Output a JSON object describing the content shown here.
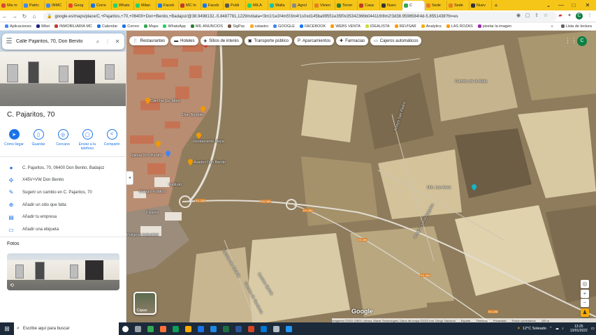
{
  "browser": {
    "tabs": [
      {
        "label": "Mis m",
        "color": "#db4437"
      },
      {
        "label": "Patric",
        "color": "#4285f4"
      },
      {
        "label": "INMC",
        "color": "#4285f4"
      },
      {
        "label": "Goog",
        "color": "#ea4335"
      },
      {
        "label": "Corre",
        "color": "#1a73e8"
      },
      {
        "label": "Whats",
        "color": "#25d366"
      },
      {
        "label": "Milan",
        "color": "#25d366"
      },
      {
        "label": "Faceb",
        "color": "#1877f2"
      },
      {
        "label": "MC In",
        "color": "#c0392b"
      },
      {
        "label": "Faceb",
        "color": "#1877f2"
      },
      {
        "label": "Publi",
        "color": "#555555"
      },
      {
        "label": "MILA",
        "color": "#25d366"
      },
      {
        "label": "Walla",
        "color": "#13c1ac"
      },
      {
        "label": "Agrol",
        "color": "#888888"
      },
      {
        "label": "Vivien",
        "color": "#e67e22"
      },
      {
        "label": "Terrer",
        "color": "#2e7d32"
      },
      {
        "label": "Casa",
        "color": "#c0392b"
      },
      {
        "label": "Nuev",
        "color": "#333333"
      },
      {
        "label": "C",
        "color": "#34a853",
        "active": true
      },
      {
        "label": "Sede",
        "color": "#e67e22"
      },
      {
        "label": "Sede",
        "color": "#e67e22"
      },
      {
        "label": "Nuev",
        "color": "#333333"
      }
    ],
    "new_tab": "+",
    "window_controls": {
      "minimize": "⌄",
      "min": "—",
      "max": "□",
      "close": "✕"
    },
    "url": "google.es/maps/place/C.+Pajaritos,+70,+06400+Don+Benito,+Badajoz/@38.9498132,-5.8487781,1229m/data=!3m1!1e3!4m5!3m4!1s0xd145ba99551e35f0x35342366b044116!8m2!3d38.9596584!4d-5.8551438?hl=es",
    "bookmarks": [
      {
        "label": "Aplicaciones",
        "color": "#4285f4"
      },
      {
        "label": "Witei",
        "color": "#1a237e"
      },
      {
        "label": "INMOBILIARIA MC",
        "color": "#c0392b"
      },
      {
        "label": "Calendar",
        "color": "#1a73e8"
      },
      {
        "label": "Correo",
        "color": "#1a73e8"
      },
      {
        "label": "Maps",
        "color": "#34a853"
      },
      {
        "label": "WhatsApp",
        "color": "#25d366"
      },
      {
        "label": "MIL ANUNCIOS",
        "color": "#2e7d32"
      },
      {
        "label": "SigPac",
        "color": "#795548"
      },
      {
        "label": "catastro",
        "color": "#f9a825"
      },
      {
        "label": "GOOGLE",
        "color": "#4285f4"
      },
      {
        "label": "FACEBOOK",
        "color": "#1877f2"
      },
      {
        "label": "WEBS VENTA",
        "color": "#ff9800"
      },
      {
        "label": "IDEALISTA",
        "color": "#cddc39"
      },
      {
        "label": "REVISAR",
        "color": "#ff9800"
      },
      {
        "label": "Analytics",
        "color": "#f9ab00"
      },
      {
        "label": "LAS ROZAS",
        "color": "#ff9800"
      },
      {
        "label": "pixelar la imagen",
        "color": "#9c27b0"
      }
    ],
    "bookmarks_more": "»",
    "reading_list": "Lista de lectura"
  },
  "sidebar": {
    "search_value": "Calle Pajaritos, 70, Don Benito",
    "place_title": "C. Pajaritos, 70",
    "actions": [
      {
        "label": "Cómo llegar",
        "icon": "directions-icon",
        "glyph": "➤"
      },
      {
        "label": "Guardar",
        "icon": "bookmark-icon",
        "glyph": "▯"
      },
      {
        "label": "Cercano",
        "icon": "nearby-icon",
        "glyph": "◎"
      },
      {
        "label": "Enviar a tu teléfono",
        "icon": "phone-icon",
        "glyph": "▢"
      },
      {
        "label": "Compartir",
        "icon": "share-icon",
        "glyph": "<"
      }
    ],
    "info": [
      {
        "text": "C. Pajaritos, 70, 06400 Don Benito, Badajoz",
        "icon": "location-pin-icon",
        "glyph": "●"
      },
      {
        "text": "X45V+VW Don Benito",
        "icon": "plus-code-icon",
        "glyph": "✣"
      },
      {
        "text": "Sugerir un cambio en C. Pajaritos, 70",
        "icon": "edit-pencil-icon",
        "glyph": "✎"
      },
      {
        "text": "Añadir un sitio que falta",
        "icon": "add-place-icon",
        "glyph": "⊕"
      },
      {
        "text": "Añadir tu empresa",
        "icon": "business-icon",
        "glyph": "▤"
      },
      {
        "text": "Añadir una etiqueta",
        "icon": "label-icon",
        "glyph": "▭"
      }
    ],
    "photos_label": "Fotos"
  },
  "map": {
    "chips": [
      {
        "label": "Restaurantes",
        "glyph": "🍴"
      },
      {
        "label": "Hoteles",
        "glyph": "▬"
      },
      {
        "label": "Sitios de interés",
        "glyph": "◈"
      },
      {
        "label": "Transporte público",
        "glyph": "▣"
      },
      {
        "label": "Aparcamientos",
        "glyph": "P"
      },
      {
        "label": "Farmacias",
        "glyph": "✚"
      },
      {
        "label": "Cajeros automáticos",
        "glyph": "▭"
      }
    ],
    "avatar_initial": "C",
    "labels": [
      "Cancha Sur Mont",
      "Don Bendito",
      "Restaurante Mejía",
      "Iglesia Don Benito",
      "Asador Don Benito",
      "Colegio Público",
      "Instituto",
      "Pisarini",
      "Camino de Antonio",
      "Camino de Gardenia",
      "Urb. Las Aves",
      "Arroyo San Pedro",
      "Arroyo Cueva Anguera",
      "Camino Quinta",
      "Camino de la Mata",
      "Polígono Industrial"
    ],
    "road_shields": [
      "EX-206",
      "EX-354",
      "EX-354",
      "EX-354",
      "EX-354",
      "EX-206"
    ],
    "layers_label": "Capas",
    "logo": "Google",
    "attribution": [
      "Imágenes ©2022 CNES / Airbus, Maxar Technologies, Datos del mapa ©2022 Inst. Geogr. Nacional",
      "España",
      "Términos",
      "Privacidad",
      "Enviar comentarios",
      "100 m"
    ],
    "controls": {
      "location": "◎",
      "zoom_in": "+",
      "zoom_out": "−",
      "pegman": "♟"
    }
  },
  "taskbar": {
    "search_placeholder": "Escribe aquí para buscar",
    "apps": [
      {
        "name": "cortana-icon",
        "color": "#ffffff"
      },
      {
        "name": "task-view-icon",
        "color": "#9aa0a6"
      },
      {
        "name": "chrome-icon",
        "color": "#34a853"
      },
      {
        "name": "firefox-icon",
        "color": "#ff7139"
      },
      {
        "name": "edge-icon",
        "color": "#0f9d58"
      },
      {
        "name": "file-explorer-icon",
        "color": "#f9ab00"
      },
      {
        "name": "media-icon",
        "color": "#1a73e8"
      },
      {
        "name": "ie-icon",
        "color": "#1e88e5"
      },
      {
        "name": "excel-icon",
        "color": "#1d6f42"
      },
      {
        "name": "word-icon",
        "color": "#2b579a"
      },
      {
        "name": "powerpoint-icon",
        "color": "#d24726"
      },
      {
        "name": "outlook-icon",
        "color": "#0078d4"
      },
      {
        "name": "paint-icon",
        "color": "#b0bec5"
      },
      {
        "name": "photos-icon",
        "color": "#2196f3"
      }
    ],
    "weather": "12°C  Soleado",
    "time": "13:25",
    "date": "13/01/2022"
  }
}
